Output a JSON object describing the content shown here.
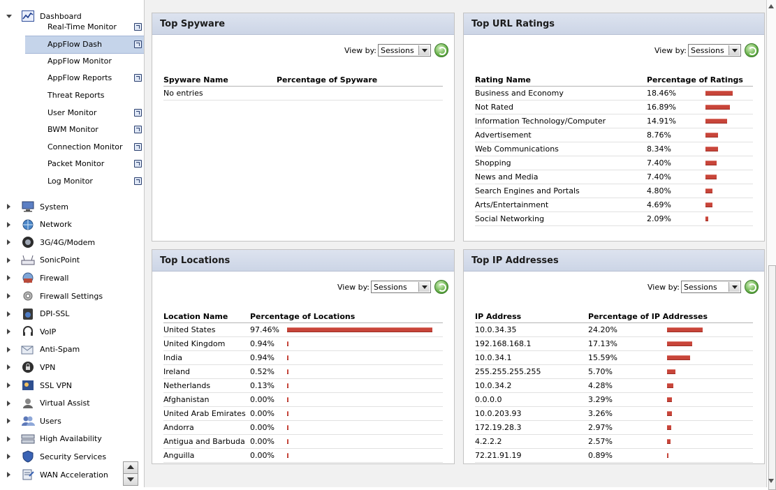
{
  "sidebar": {
    "dashboard": {
      "label": "Dashboard",
      "icon": "dashboard-chart-icon",
      "expanded": true,
      "items": [
        {
          "label": "Real-Time Monitor",
          "popout": true,
          "selected": false
        },
        {
          "label": "AppFlow Dash",
          "popout": true,
          "selected": true
        },
        {
          "label": "AppFlow Monitor",
          "popout": false,
          "selected": false
        },
        {
          "label": "AppFlow Reports",
          "popout": true,
          "selected": false
        },
        {
          "label": "Threat Reports",
          "popout": false,
          "selected": false
        },
        {
          "label": "User Monitor",
          "popout": true,
          "selected": false
        },
        {
          "label": "BWM Monitor",
          "popout": true,
          "selected": false
        },
        {
          "label": "Connection Monitor",
          "popout": true,
          "selected": false
        },
        {
          "label": "Packet Monitor",
          "popout": true,
          "selected": false
        },
        {
          "label": "Log Monitor",
          "popout": true,
          "selected": false
        }
      ]
    },
    "categories": [
      {
        "label": "System",
        "icon": "system-monitor-icon"
      },
      {
        "label": "Network",
        "icon": "network-globe-icon"
      },
      {
        "label": "3G/4G/Modem",
        "icon": "modem-icon"
      },
      {
        "label": "SonicPoint",
        "icon": "access-point-icon"
      },
      {
        "label": "Firewall",
        "icon": "firewall-icon"
      },
      {
        "label": "Firewall Settings",
        "icon": "firewall-settings-icon"
      },
      {
        "label": "DPI-SSL",
        "icon": "dpi-ssl-icon"
      },
      {
        "label": "VoIP",
        "icon": "headset-icon"
      },
      {
        "label": "Anti-Spam",
        "icon": "anti-spam-icon"
      },
      {
        "label": "VPN",
        "icon": "vpn-lock-icon"
      },
      {
        "label": "SSL VPN",
        "icon": "ssl-vpn-icon"
      },
      {
        "label": "Virtual Assist",
        "icon": "virtual-assist-icon"
      },
      {
        "label": "Users",
        "icon": "users-icon"
      },
      {
        "label": "High Availability",
        "icon": "high-availability-icon"
      },
      {
        "label": "Security Services",
        "icon": "shield-icon"
      },
      {
        "label": "WAN Acceleration",
        "icon": "wan-acceleration-icon"
      }
    ]
  },
  "panels": {
    "spyware": {
      "title": "Top Spyware",
      "viewby_label": "View by:",
      "viewby_value": "Sessions",
      "columns": [
        "Spyware Name",
        "Percentage of Spyware"
      ],
      "empty_text": "No entries"
    },
    "url_ratings": {
      "title": "Top URL Ratings",
      "viewby_label": "View by:",
      "viewby_value": "Sessions",
      "columns": [
        "Rating Name",
        "Percentage of Ratings"
      ],
      "rows": [
        {
          "name": "Business and Economy",
          "pct": "18.46%",
          "value": 18.46
        },
        {
          "name": "Not Rated",
          "pct": "16.89%",
          "value": 16.89
        },
        {
          "name": "Information Technology/Computer",
          "pct": "14.91%",
          "value": 14.91
        },
        {
          "name": "Advertisement",
          "pct": "8.76%",
          "value": 8.76
        },
        {
          "name": "Web Communications",
          "pct": "8.34%",
          "value": 8.34
        },
        {
          "name": "Shopping",
          "pct": "7.40%",
          "value": 7.4
        },
        {
          "name": "News and Media",
          "pct": "7.40%",
          "value": 7.4
        },
        {
          "name": "Search Engines and Portals",
          "pct": "4.80%",
          "value": 4.8
        },
        {
          "name": "Arts/Entertainment",
          "pct": "4.69%",
          "value": 4.69
        },
        {
          "name": "Social Networking",
          "pct": "2.09%",
          "value": 2.09
        }
      ]
    },
    "locations": {
      "title": "Top Locations",
      "viewby_label": "View by:",
      "viewby_value": "Sessions",
      "columns": [
        "Location Name",
        "Percentage of Locations"
      ],
      "rows": [
        {
          "name": "United States",
          "pct": "97.46%",
          "value": 97.46
        },
        {
          "name": "United Kingdom",
          "pct": "0.94%",
          "value": 0.94
        },
        {
          "name": "India",
          "pct": "0.94%",
          "value": 0.94
        },
        {
          "name": "Ireland",
          "pct": "0.52%",
          "value": 0.52
        },
        {
          "name": "Netherlands",
          "pct": "0.13%",
          "value": 0.13
        },
        {
          "name": "Afghanistan",
          "pct": "0.00%",
          "value": 0.0
        },
        {
          "name": "United Arab Emirates",
          "pct": "0.00%",
          "value": 0.0
        },
        {
          "name": "Andorra",
          "pct": "0.00%",
          "value": 0.0
        },
        {
          "name": "Antigua and Barbuda",
          "pct": "0.00%",
          "value": 0.0
        },
        {
          "name": "Anguilla",
          "pct": "0.00%",
          "value": 0.0
        }
      ]
    },
    "ip_addresses": {
      "title": "Top IP Addresses",
      "viewby_label": "View by:",
      "viewby_value": "Sessions",
      "columns": [
        "IP Address",
        "Percentage of IP Addresses"
      ],
      "rows": [
        {
          "name": "10.0.34.35",
          "pct": "24.20%",
          "value": 24.2
        },
        {
          "name": "192.168.168.1",
          "pct": "17.13%",
          "value": 17.13
        },
        {
          "name": "10.0.34.1",
          "pct": "15.59%",
          "value": 15.59
        },
        {
          "name": "255.255.255.255",
          "pct": "5.70%",
          "value": 5.7
        },
        {
          "name": "10.0.34.2",
          "pct": "4.28%",
          "value": 4.28
        },
        {
          "name": "0.0.0.0",
          "pct": "3.29%",
          "value": 3.29
        },
        {
          "name": "10.0.203.93",
          "pct": "3.26%",
          "value": 3.26
        },
        {
          "name": "172.19.28.3",
          "pct": "2.97%",
          "value": 2.97
        },
        {
          "name": "4.2.2.2",
          "pct": "2.57%",
          "value": 2.57
        },
        {
          "name": "72.21.91.19",
          "pct": "0.89%",
          "value": 0.89
        }
      ]
    }
  },
  "colors": {
    "bar": "#c8453a",
    "selected_row": "#c5d4ea",
    "panel_header": "#d3dbea"
  }
}
